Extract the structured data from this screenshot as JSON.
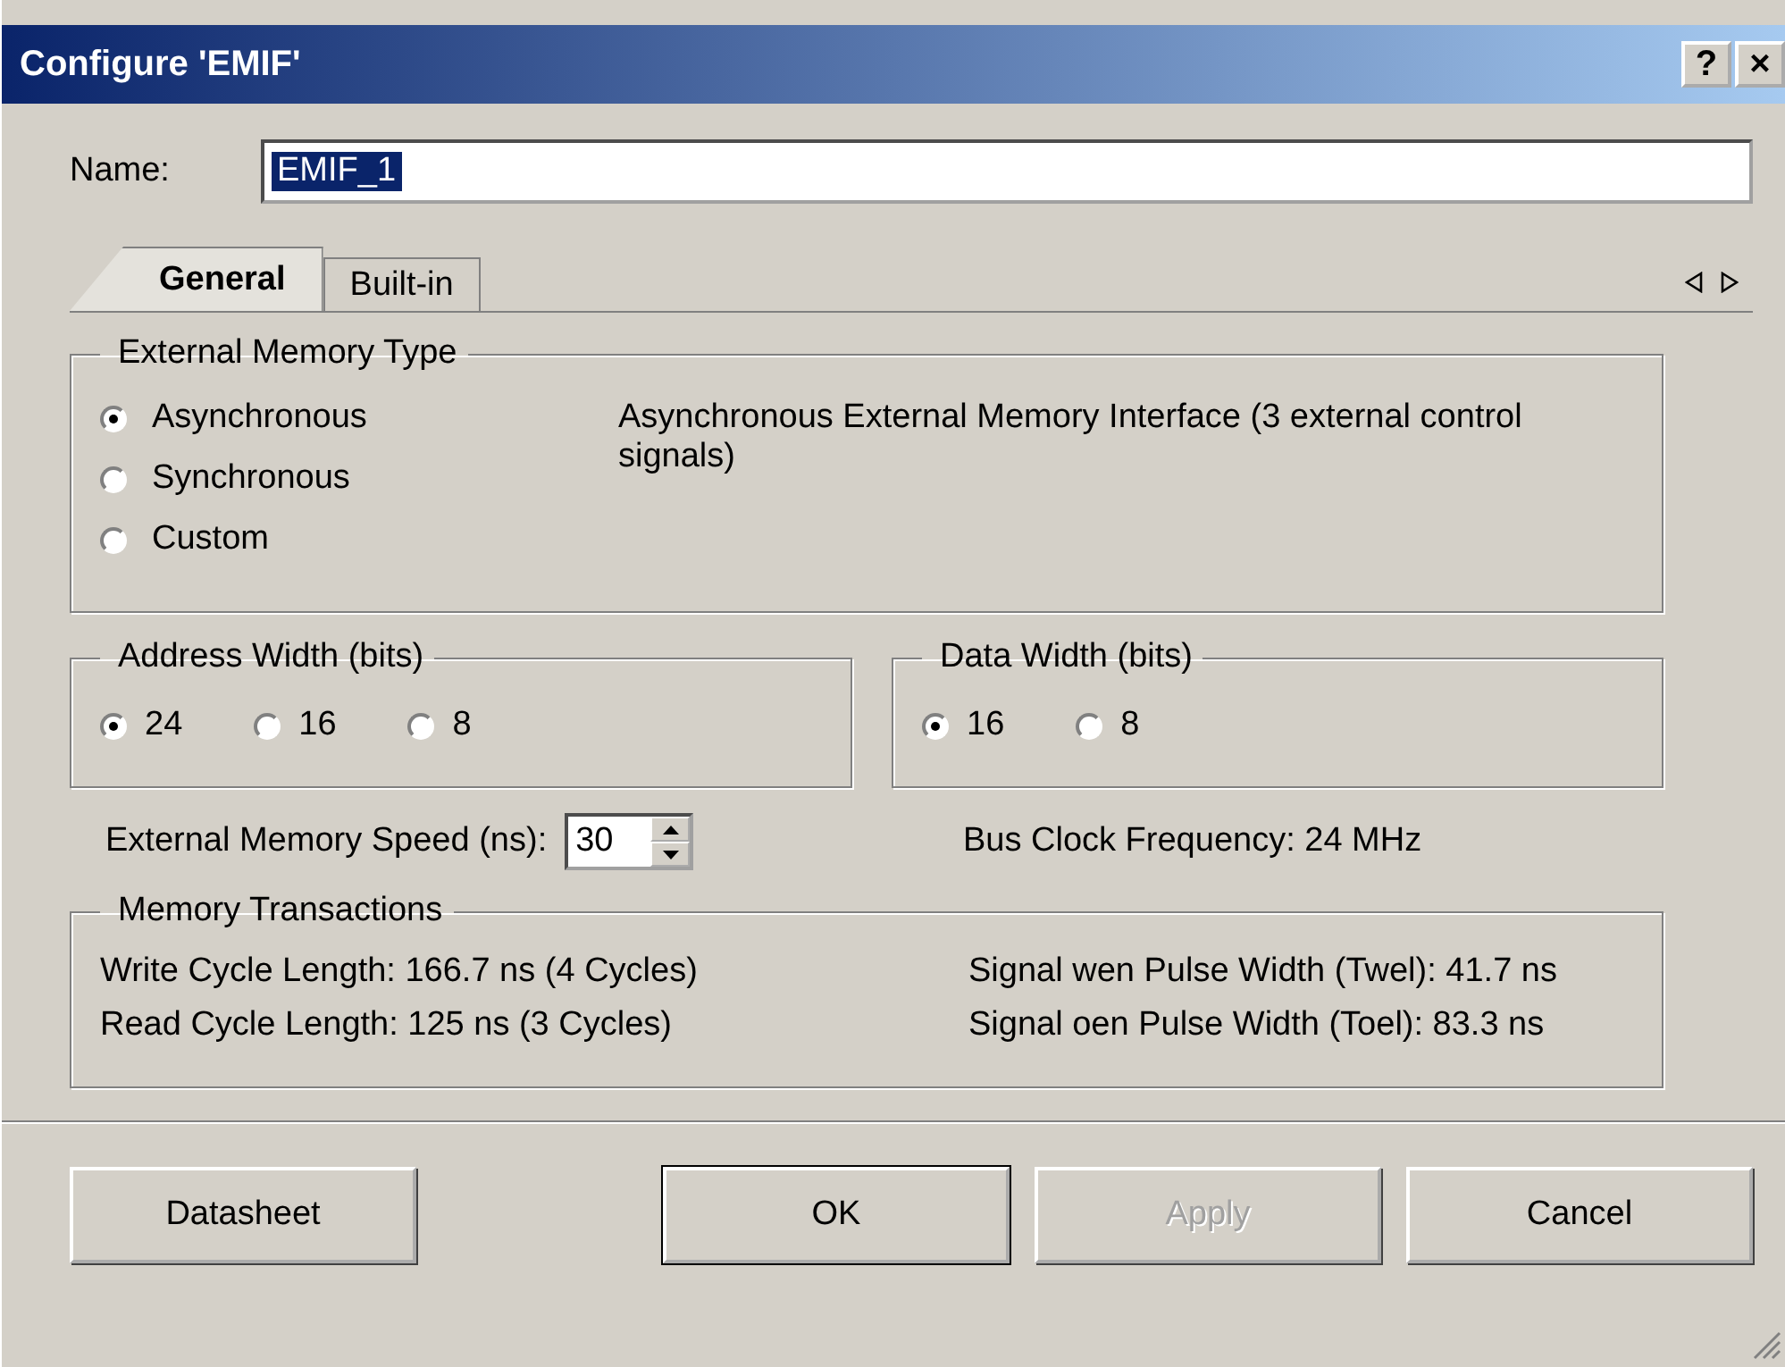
{
  "window": {
    "title": "Configure 'EMIF'",
    "help": "?",
    "close": "×"
  },
  "name_field": {
    "label": "Name:",
    "value": "EMIF_1"
  },
  "tabs": [
    {
      "label": "General",
      "selected": true
    },
    {
      "label": "Built-in",
      "selected": false
    }
  ],
  "memory_type": {
    "title": "External Memory Type",
    "description": "Asynchronous External Memory Interface (3 external control signals)",
    "options": [
      {
        "label": "Asynchronous",
        "selected": true
      },
      {
        "label": "Synchronous",
        "selected": false
      },
      {
        "label": "Custom",
        "selected": false
      }
    ]
  },
  "address_width": {
    "title": "Address Width (bits)",
    "options": [
      {
        "label": "24",
        "selected": true
      },
      {
        "label": "16",
        "selected": false
      },
      {
        "label": "8",
        "selected": false
      }
    ]
  },
  "data_width": {
    "title": "Data Width (bits)",
    "options": [
      {
        "label": "16",
        "selected": true
      },
      {
        "label": "8",
        "selected": false
      }
    ]
  },
  "speed": {
    "label": "External Memory Speed (ns):",
    "value": "30"
  },
  "bus_clock": "Bus Clock Frequency: 24 MHz",
  "transactions": {
    "title": "Memory Transactions",
    "rows": [
      {
        "left": "Write Cycle Length: 166.7 ns (4 Cycles)",
        "right": "Signal wen Pulse Width (Twel): 41.7 ns"
      },
      {
        "left": "Read Cycle Length: 125 ns (3 Cycles)",
        "right": "Signal oen Pulse Width (Toel):  83.3 ns"
      }
    ]
  },
  "buttons": [
    {
      "label": "Datasheet",
      "disabled": false,
      "default": false
    },
    {
      "label": "OK",
      "disabled": false,
      "default": true
    },
    {
      "label": "Apply",
      "disabled": true,
      "default": false
    },
    {
      "label": "Cancel",
      "disabled": false,
      "default": false
    }
  ]
}
